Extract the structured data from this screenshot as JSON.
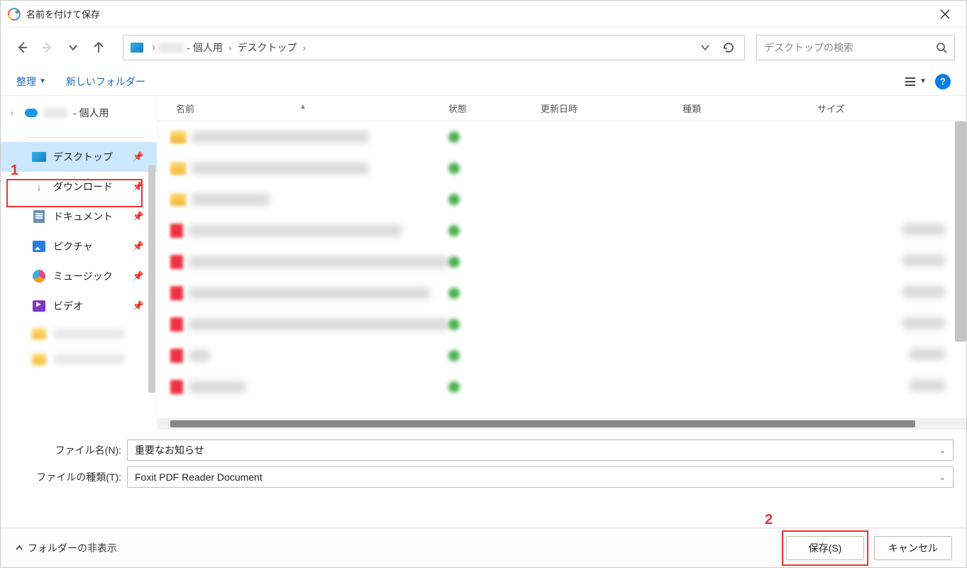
{
  "window": {
    "title": "名前を付けて保存"
  },
  "nav": {
    "breadcrumb_personal_suffix": " - 個人用",
    "breadcrumb_location": "デスクトップ",
    "search_placeholder": "デスクトップの検索"
  },
  "toolbar": {
    "organize": "整理",
    "new_folder": "新しいフォルダー"
  },
  "sidebar": {
    "personal_suffix": " - 個人用",
    "items": [
      {
        "label": "デスクトップ",
        "icon": "desktop"
      },
      {
        "label": "ダウンロード",
        "icon": "download"
      },
      {
        "label": "ドキュメント",
        "icon": "document"
      },
      {
        "label": "ピクチャ",
        "icon": "pictures"
      },
      {
        "label": "ミュージック",
        "icon": "music"
      },
      {
        "label": "ビデオ",
        "icon": "video"
      }
    ]
  },
  "columns": {
    "name": "名前",
    "state": "状態",
    "date": "更新日時",
    "type": "種類",
    "size": "サイズ"
  },
  "file_rows": [
    {
      "icon": "folder",
      "name_w": 250,
      "date_w": 110,
      "type_w": 100,
      "size_w": 0
    },
    {
      "icon": "folder",
      "name_w": 250,
      "date_w": 110,
      "type_w": 100,
      "size_w": 0
    },
    {
      "icon": "folder",
      "name_w": 110,
      "date_w": 110,
      "type_w": 100,
      "size_w": 0
    },
    {
      "icon": "file",
      "name_w": 300,
      "date_w": 110,
      "type_w": 150,
      "size_w": 60
    },
    {
      "icon": "file",
      "name_w": 370,
      "date_w": 110,
      "type_w": 150,
      "size_w": 60
    },
    {
      "icon": "file",
      "name_w": 340,
      "date_w": 110,
      "type_w": 150,
      "size_w": 60
    },
    {
      "icon": "file",
      "name_w": 370,
      "date_w": 110,
      "type_w": 150,
      "size_w": 60
    },
    {
      "icon": "file",
      "name_w": 30,
      "date_w": 110,
      "type_w": 150,
      "size_w": 50
    },
    {
      "icon": "file",
      "name_w": 80,
      "date_w": 110,
      "type_w": 150,
      "size_w": 50
    }
  ],
  "inputs": {
    "filename_label": "ファイル名(N):",
    "filename_value": "重要なお知らせ",
    "filetype_label": "ファイルの種類(T):",
    "filetype_value": "Foxit PDF Reader Document"
  },
  "footer": {
    "hide_folders": "フォルダーの非表示",
    "save": "保存(S)",
    "cancel": "キャンセル"
  },
  "annotations": {
    "one": "1",
    "two": "2"
  }
}
